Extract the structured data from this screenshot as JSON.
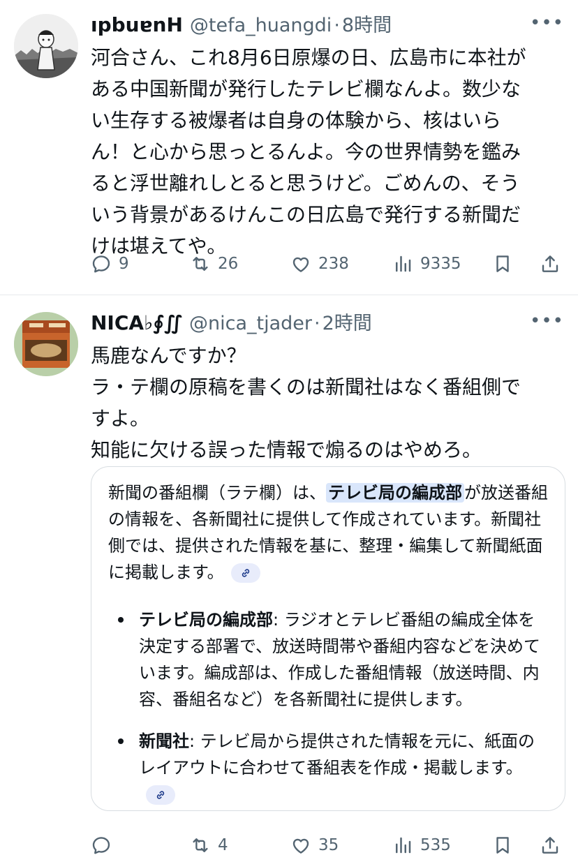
{
  "tweets": [
    {
      "display_name": "ıpbuɐnH",
      "handle": "@tefa_huangdi",
      "dot": "·",
      "time": "8時間",
      "more_icon": "more-horizontal-icon",
      "more_label": "•••",
      "text": "河合さん、これ8月6日原爆の日、広島市に本社が\nある中国新聞が発行したテレビ欄なんよ。数少な\nい生存する被爆者は自身の体験から、核はいら\nん！と心から思っとるんよ。今の世界情勢を鑑み\nると浮世離れしとると思うけど。ごめんの、そう\nいう背景があるけんこの日広島で発行する新聞だ\nけは堪えてや。",
      "replies": "9",
      "retweets": "26",
      "likes": "238",
      "views": "9335"
    },
    {
      "display_name": "NICA♭∮∬",
      "handle": "@nica_tjader",
      "dot": "·",
      "time": "2時間",
      "more_label": "•••",
      "text": "馬鹿なんですか？\nラ・テ欄の原稿を書くのは新聞社はなく番組側で\nすよ。\n知能に欠ける誤った情報で煽るのはやめろ。",
      "card": {
        "p1_before": "新聞の番組欄（ラテ欄）は、",
        "p1_highlight": "テレビ局の編成部",
        "p1_after": "が放送番組の情報を、各新聞社に提供して作成されています。新聞社側では、提供された情報を基に、整理・編集して新聞紙面に掲載します。",
        "bullets": [
          {
            "term": "テレビ局の編成部",
            "text": ": ラジオとテレビ番組の編成全体を決定する部署で、放送時間帯や番組内容などを決めています。編成部は、作成した番組情報（放送時間、内容、番組名など）を各新聞社に提供します。"
          },
          {
            "term": "新聞社",
            "text": ": テレビ局から提供された情報を元に、紙面のレイアウトに合わせて番組表を作成・掲載します。"
          }
        ]
      },
      "replies": "",
      "retweets": "4",
      "likes": "35",
      "views": "535"
    }
  ]
}
